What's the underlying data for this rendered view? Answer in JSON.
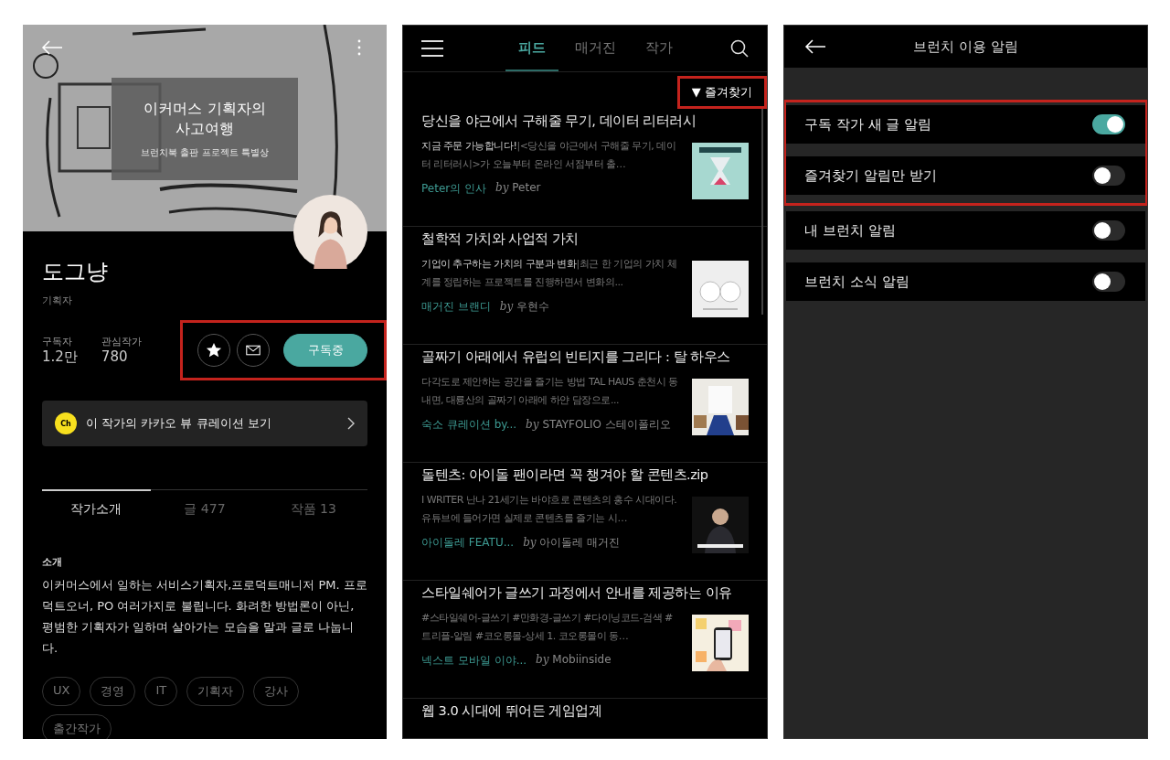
{
  "profile_screen": {
    "cover": {
      "book_title": "이커머스 기획자의\n사고여행",
      "award": "브런치북 출판 프로젝트 특별상"
    },
    "name": "도그냥",
    "role": "기획자",
    "stats": [
      {
        "label": "구독자",
        "value": "1.2만"
      },
      {
        "label": "관심작가",
        "value": "780"
      }
    ],
    "actions": {
      "highlighted": true,
      "subscribe_label": "구독중",
      "subscribed": true
    },
    "kakao_banner": {
      "badge": "Ch",
      "text": "이 작가의 카카오 뷰 큐레이션 보기"
    },
    "tabs": [
      {
        "label": "작가소개",
        "selected": true
      },
      {
        "label": "글 477",
        "selected": false
      },
      {
        "label": "작품 13",
        "selected": false
      }
    ],
    "intro": {
      "heading": "소개",
      "text": "이커머스에서 일하는 서비스기획자,프로덕트매니저 PM. 프로덕트오너, PO 여러가지로 불립니다. 화려한 방법론이 아닌, 평범한 기획자가 일하며 살아가는 모습을 말과 글로 나눕니다."
    },
    "tags": [
      "UX",
      "경영",
      "IT",
      "기획자",
      "강사",
      "출간작가"
    ]
  },
  "feed_screen": {
    "tabs": [
      {
        "label": "피드",
        "selected": true
      },
      {
        "label": "매거진",
        "selected": false
      },
      {
        "label": "작가",
        "selected": false
      }
    ],
    "filter": {
      "label": "▼ 즐겨찾기",
      "highlighted": true
    },
    "articles": [
      {
        "title": "당신을 야근에서 구해줄 무기, 데이터 리터러시",
        "lead": "지금 주문 가능합니다!",
        "separator": "|",
        "excerpt": "<당신을 야근에서 구해줄 무기, 데이터 리터러시>가 오늘부터 온라인 서점부터 출…",
        "source": "Peter의 인사",
        "author": "*by* Peter"
      },
      {
        "title": "철학적 가치와 사업적 가치",
        "lead": "기업이 추구하는 가치의 구분과 변화",
        "separator": "|",
        "excerpt": "최근 한 기업의 가치 체계를 정립하는 프로젝트를 진행하면서 변화의...",
        "source": "매거진 브랜디",
        "author": "*by* 우현수"
      },
      {
        "title": "골짜기 아래에서 유럽의 빈티지를 그리다 : 탈 하우스",
        "excerpt": "다각도로 제안하는 공간을 즐기는 방법 TAL HAUS 춘천시 동내면, 대룡산의 골짜기 아래에 하얀 담장으로...",
        "source": "숙소 큐레이션 by...",
        "author": "*by* STAYFOLIO 스테이폴리오"
      },
      {
        "title": "돌텐츠: 아이돌 팬이라면 꼭 챙겨야 할 콘텐츠.zip",
        "excerpt": "I WRITER 난나  21세기는 바야흐로 콘텐츠의 홍수 시대이다. 유튜브에 들어가면 실제로 콘텐츠를 즐기는 시…",
        "source": "아이돌레 FEATU...",
        "author": "*by* 아이돌레 매거진"
      },
      {
        "title": "스타일쉐어가 글쓰기 과정에서 안내를 제공하는 이유",
        "excerpt": "#스타일쉐어-글쓰기 #만화경-글쓰기 #다이닝코드-검색 #트리플-알림 #코오롱몰-상세   1. 코오롱몰이 동…",
        "source": "넥스트 모바일 이야...",
        "author": "*by* Mobiinside"
      },
      {
        "title": "웹 3.0 시대에 뛰어든 게임업계"
      }
    ]
  },
  "settings_screen": {
    "title": "브런치 이용 알림",
    "groups": [
      {
        "highlighted": true,
        "rows": [
          {
            "label": "구독 작가 새 글 알림",
            "on": true
          },
          {
            "label": "즐겨찾기 알림만 받기",
            "on": false
          }
        ]
      },
      {
        "highlighted": false,
        "rows": [
          {
            "label": "내 브런치 알림",
            "on": false
          },
          {
            "label": "브런치 소식 알림",
            "on": false
          }
        ]
      }
    ]
  }
}
